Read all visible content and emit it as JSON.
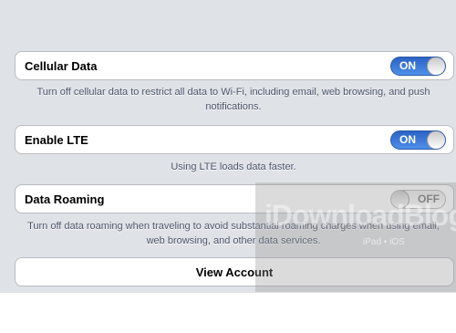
{
  "settings": {
    "cellular_data": {
      "label": "Cellular Data",
      "toggle": "ON",
      "footer": "Turn off cellular data to restrict all data to Wi-Fi, including email, web browsing, and push notifications."
    },
    "enable_lte": {
      "label": "Enable LTE",
      "toggle": "ON",
      "footer": "Using LTE loads data faster."
    },
    "data_roaming": {
      "label": "Data Roaming",
      "toggle": "OFF",
      "footer": "Turn off data roaming when traveling to avoid substantial roaming charges when using email, web browsing, and other data services."
    },
    "view_account": {
      "label": "View Account"
    }
  },
  "watermark": {
    "text": "iDownloadBlog",
    "sub": "iPad • iOS"
  },
  "colors": {
    "background": "#dfe2e6",
    "switch_on": "#3a76d8",
    "footer_text": "#4c566c"
  }
}
